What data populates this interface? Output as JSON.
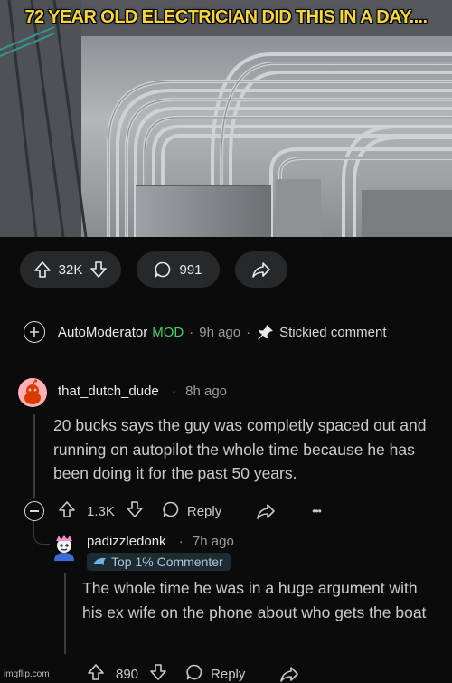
{
  "meme_title": "72 YEAR OLD ELECTRICIAN DID THIS IN A DAY....",
  "post_actions": {
    "upvote_icon": "arrow-up-icon",
    "downvote_icon": "arrow-down-icon",
    "vote_count": "32K",
    "comment_icon": "speech-bubble-icon",
    "comment_count": "991",
    "share_icon": "share-arrow-icon"
  },
  "automod": {
    "expand_icon": "plus-circle-icon",
    "username": "AutoModerator",
    "mod_badge": "MOD",
    "time": "9h ago",
    "pin_icon": "pin-icon",
    "sticky_label": "Stickied comment"
  },
  "comment": {
    "username": "that_dutch_dude",
    "time": "8h ago",
    "body": "20 bucks says the guy was completly spaced out and running on autopilot the whole time because he has been doing it for the past 50 years.",
    "vote_count": "1.3K",
    "reply_label": "Reply",
    "more_label": "•••"
  },
  "reply": {
    "username": "padizzledonk",
    "time": "7h ago",
    "flair": "Top 1% Commenter",
    "body": "The whole time he was in a huge argument with his ex wife on the phone about who gets the boat",
    "vote_count": "890",
    "reply_label": "Reply"
  },
  "watermark": "imgflip.com",
  "colors": {
    "background": "#0b0b0c",
    "pill": "#26282a",
    "mod_green": "#46d160",
    "meme_yellow": "#f6d53b",
    "avatar_pink": "#ffb0b4"
  }
}
